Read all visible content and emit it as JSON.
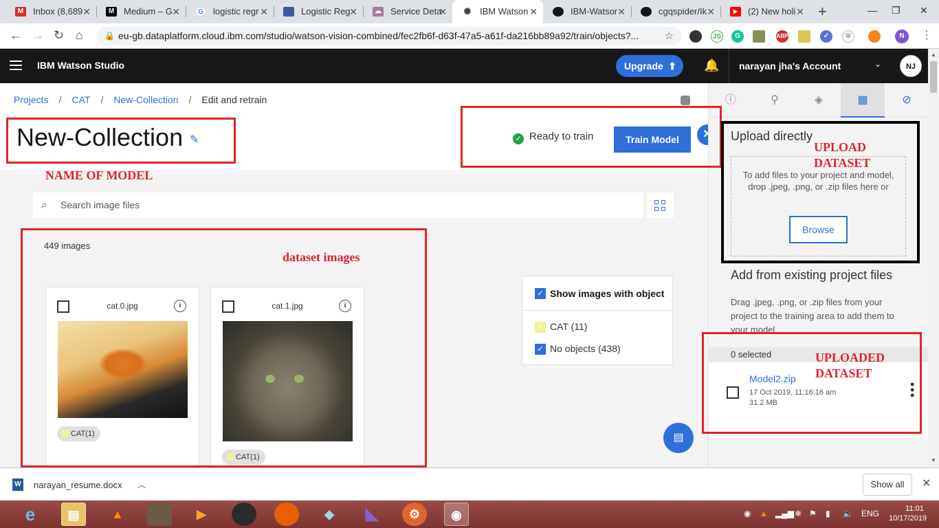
{
  "browser": {
    "tabs": [
      {
        "label": "Inbox (8,689",
        "icon": "gmail-icon",
        "color": "#d93025",
        "glyph": "M"
      },
      {
        "label": "Medium – G",
        "icon": "medium-icon",
        "color": "#000000",
        "glyph": "M"
      },
      {
        "label": "logistic regr",
        "icon": "google-icon",
        "color": "#4285f4",
        "glyph": "G"
      },
      {
        "label": "Logistic Reg",
        "icon": "doc-icon",
        "color": "#3b5b9a",
        "glyph": "▬"
      },
      {
        "label": "Service Deta",
        "icon": "cloud-icon",
        "color": "#a77aa0",
        "glyph": "☁"
      },
      {
        "label": "IBM Watson",
        "icon": "watson-icon",
        "color": "#444444",
        "glyph": "✺"
      },
      {
        "label": "IBM-Watsor",
        "icon": "github-icon",
        "color": "#181717",
        "glyph": "●"
      },
      {
        "label": "cgqspider/Ik",
        "icon": "github-icon",
        "color": "#181717",
        "glyph": "●"
      },
      {
        "label": "(2) New holi",
        "icon": "youtube-icon",
        "color": "#ff0000",
        "glyph": "▶"
      }
    ],
    "url": "eu-gb.dataplatform.cloud.ibm.com/studio/watson-vision-combined/fec2fb6f-d63f-47a5-a61f-da216bb89a92/train/objects?...",
    "profile_initial": "N"
  },
  "header": {
    "brand": "IBM Watson Studio",
    "upgrade_label": "Upgrade",
    "account": "narayan jha's Account",
    "avatar_initials": "NJ"
  },
  "breadcrumb": {
    "items": [
      "Projects",
      "CAT",
      "New-Collection"
    ],
    "current": "Edit and retrain"
  },
  "model": {
    "title": "New-Collection",
    "status": "Ready to train",
    "train_button": "Train Model"
  },
  "search": {
    "placeholder": "Search image files"
  },
  "images": {
    "count": "449 images",
    "cards": [
      {
        "filename": "cat.0.jpg",
        "tag": "CAT(1)"
      },
      {
        "filename": "cat.1.jpg",
        "tag": "CAT(1)"
      }
    ]
  },
  "filter": {
    "header": "Show images with object",
    "rows": [
      "CAT (11)",
      "No objects (438)"
    ]
  },
  "right_panel": {
    "upload_title": "Upload directly",
    "dropzone_text": "To add files to your project and model, drop .jpeg, .png, or .zip files here or",
    "browse_label": "Browse",
    "add_from_title": "Add from existing project files",
    "drag_text": "Drag .jpeg, .png, or .zip files from your project to the training area to add them to your model",
    "selected": "0 selected",
    "file": {
      "name": "Model2.zip",
      "date": "17 Oct 2019, 11:16:16 am",
      "size": "31.2 MB"
    }
  },
  "annotations": {
    "name_of_model": "NAME OF MODEL",
    "dataset_images": "dataset images",
    "upload_dataset": "UPLOAD DATASET",
    "uploaded_dataset": "UPLOADED DATASET"
  },
  "download_shelf": {
    "filename": "narayan_resume.docx",
    "show_all": "Show all"
  },
  "taskbar": {
    "language": "ENG",
    "time": "11:01",
    "date": "10/17/2019"
  },
  "colors": {
    "accent": "#2f6fd8",
    "annotation": "#e2232a",
    "header_bg": "#171717",
    "taskbar": "#8a3d3a"
  }
}
